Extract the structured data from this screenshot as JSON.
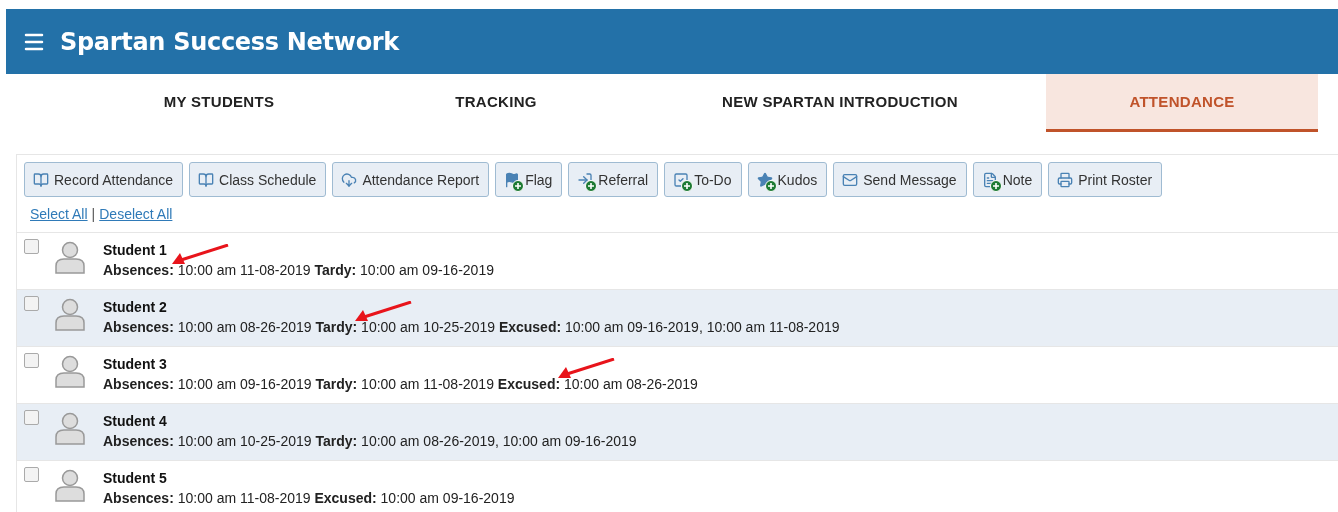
{
  "header": {
    "title": "Spartan Success Network"
  },
  "tabs": [
    {
      "label": "MY STUDENTS",
      "selected": false
    },
    {
      "label": "TRACKING",
      "selected": false
    },
    {
      "label": "NEW SPARTAN INTRODUCTION",
      "selected": false
    },
    {
      "label": "ATTENDANCE",
      "selected": true
    }
  ],
  "toolbar": [
    "Record Attendance",
    "Class Schedule",
    "Attendance Report",
    "Flag",
    "Referral",
    "To-Do",
    "Kudos",
    "Send Message",
    "Note",
    "Print Roster"
  ],
  "selection_links": {
    "items": [
      "Select All",
      "Deselect All"
    ],
    "separator": "|"
  },
  "students": [
    {
      "name": "Student 1",
      "checked": false,
      "entries": [
        {
          "label": "Absences:",
          "value": "10:00 am 11-08-2019",
          "arrow": true
        },
        {
          "label": "Tardy:",
          "value": "10:00 am 09-16-2019"
        }
      ]
    },
    {
      "name": "Student 2",
      "checked": false,
      "entries": [
        {
          "label": "Absences:",
          "value": "10:00 am 08-26-2019"
        },
        {
          "label": "Tardy:",
          "value": "10:00 am 10-25-2019",
          "arrow": true
        },
        {
          "label": "Excused:",
          "value": "10:00 am 09-16-2019, 10:00 am 11-08-2019"
        }
      ]
    },
    {
      "name": "Student 3",
      "checked": false,
      "entries": [
        {
          "label": "Absences:",
          "value": "10:00 am 09-16-2019"
        },
        {
          "label": "Tardy:",
          "value": "10:00 am 11-08-2019"
        },
        {
          "label": "Excused:",
          "value": "10:00 am 08-26-2019",
          "arrow": true
        }
      ]
    },
    {
      "name": "Student 4",
      "checked": false,
      "entries": [
        {
          "label": "Absences:",
          "value": "10:00 am 10-25-2019"
        },
        {
          "label": "Tardy:",
          "value": "10:00 am 08-26-2019, 10:00 am 09-16-2019"
        }
      ]
    },
    {
      "name": "Student 5",
      "checked": false,
      "entries": [
        {
          "label": "Absences:",
          "value": "10:00 am 11-08-2019"
        },
        {
          "label": "Excused:",
          "value": "10:00 am 09-16-2019"
        }
      ]
    }
  ]
}
